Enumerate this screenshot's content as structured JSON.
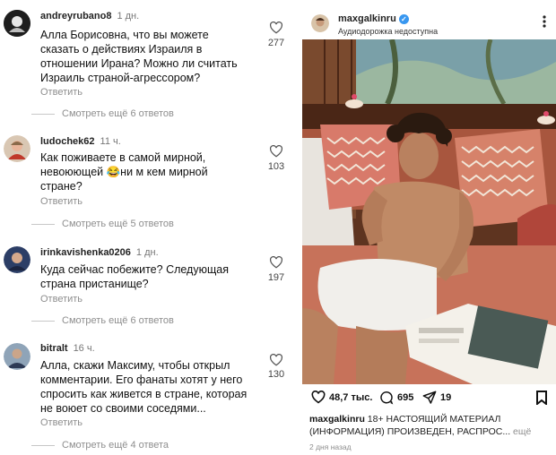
{
  "comments": [
    {
      "username": "andreyrubano8",
      "time": "1 дн.",
      "lines": [
        "Алла Борисовна, что вы можете",
        "сказать о действиях Израиля в",
        "отношении Ирана? Можно ли считать",
        "Израиль страной-агрессором?"
      ],
      "reply": "Ответить",
      "likes": "277",
      "view_replies": "Смотреть ещё 6 ответов"
    },
    {
      "username": "ludochek62",
      "time": "11 ч.",
      "lines": [
        "Как поживаете в самой мирной,",
        "невоюющей 😂ни м кем мирной",
        "стране?"
      ],
      "reply": "Ответить",
      "likes": "103",
      "view_replies": "Смотреть ещё 5 ответов"
    },
    {
      "username": "irinkavishenka0206",
      "time": "1 дн.",
      "lines": [
        "Куда сейчас побежите? Следующая",
        "страна пристанище?"
      ],
      "reply": "Ответить",
      "likes": "197",
      "view_replies": "Смотреть ещё 6 ответов"
    },
    {
      "username": "bitralt",
      "time": "16 ч.",
      "lines": [
        "Алла, скажи Максиму, чтобы открыл",
        "комментарии. Его фанаты хотят у него",
        "спросить как живется в стране, которая",
        "не воюет со своими соседями..."
      ],
      "reply": "Ответить",
      "likes": "130",
      "view_replies": "Смотреть ещё 4 ответа"
    }
  ],
  "post": {
    "username": "maxgalkinru",
    "audio": "Аудиодорожка недоступна",
    "likes": "48,7 тыс.",
    "comments_count": "695",
    "shares": "19",
    "caption_user": "maxgalkinru",
    "caption_text": "18+ НАСТОЯЩИЙ МАТЕРИАЛ (ИНФОРМАЦИЯ)  ПРОИЗВЕДЕН, РАСПРОС...",
    "caption_more": "ещё",
    "date": "2 дня назад"
  },
  "icons": [
    "heart-icon",
    "comment-icon",
    "share-icon",
    "bookmark-icon",
    "verified-icon",
    "more-options-icon"
  ],
  "colors": {
    "verified": "#3897f0",
    "muted": "#8e8e8e",
    "sofa": "#c7725a",
    "wall": "#6b3a22"
  }
}
